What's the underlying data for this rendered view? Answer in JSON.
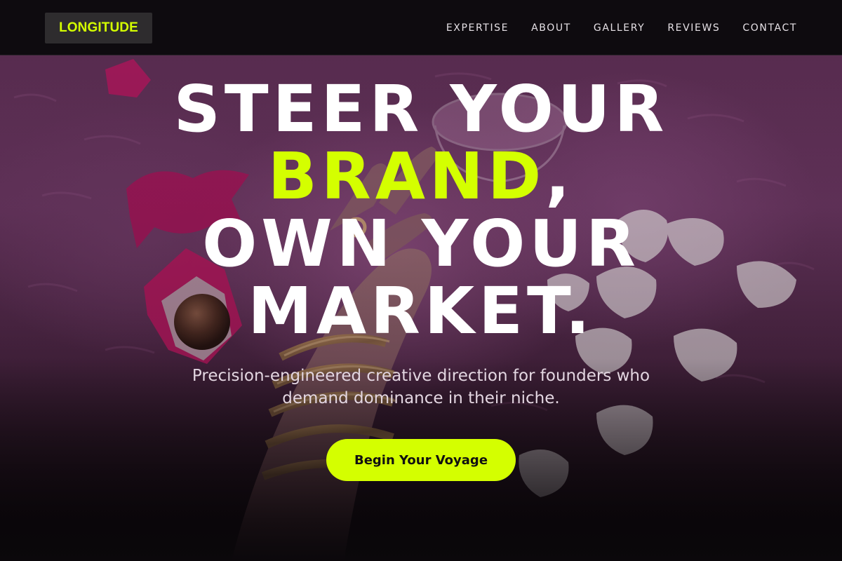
{
  "brand": {
    "logo_text": "LONGITUDE",
    "accent_color": "#d4ff00"
  },
  "nav": {
    "items": [
      {
        "label": "EXPERTISE"
      },
      {
        "label": "ABOUT"
      },
      {
        "label": "GALLERY"
      },
      {
        "label": "REVIEWS"
      },
      {
        "label": "CONTACT"
      }
    ]
  },
  "hero": {
    "headline_line1": "STEER YOUR",
    "headline_accent": "BRAND",
    "headline_punct": ",",
    "headline_line3": "OWN YOUR",
    "headline_line4": "MARKET.",
    "subtitle": "Precision-engineered creative direction for founders who demand dominance in their niche.",
    "cta_label": "Begin Your Voyage",
    "background_image": "hand-with-gold-bracelets-chocolates-petals-on-pink-fur"
  }
}
